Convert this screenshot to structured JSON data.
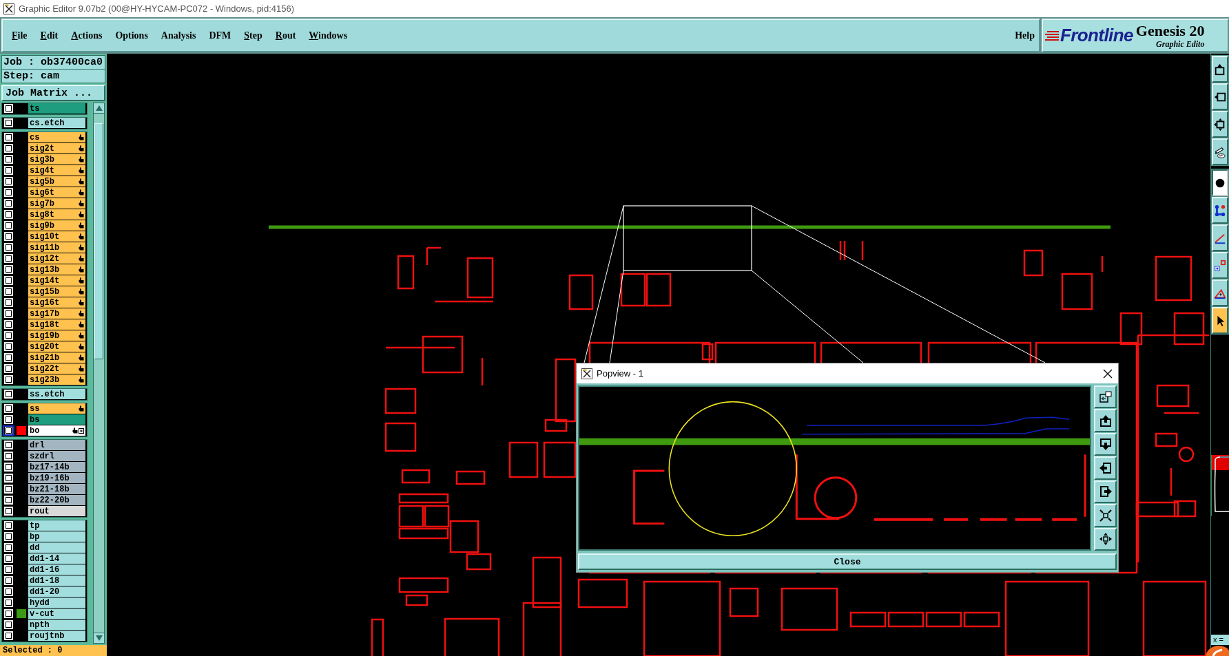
{
  "window": {
    "title": "Graphic Editor 9.07b2 (00@HY-HYCAM-PC072 - Windows, pid:4156)"
  },
  "menu_bar": {
    "items": [
      {
        "label": "File",
        "mnemonic": true
      },
      {
        "label": "Edit",
        "mnemonic": true
      },
      {
        "label": "Actions",
        "mnemonic": true
      },
      {
        "label": "Options",
        "mnemonic": false
      },
      {
        "label": "Analysis",
        "mnemonic": false
      },
      {
        "label": "DFM",
        "mnemonic": false
      },
      {
        "label": "Step",
        "mnemonic": true
      },
      {
        "label": "Rout",
        "mnemonic": true
      },
      {
        "label": "Windows",
        "mnemonic": true
      }
    ],
    "help": "Help"
  },
  "logo": {
    "brand": "Frontline",
    "product": "Genesis 20",
    "subtitle": "Graphic Edito"
  },
  "job_panel": {
    "job": "Job : ob37400ca0",
    "step": "Step: cam",
    "matrix_button": "Job Matrix ...",
    "layer_groups": [
      {
        "layers": [
          {
            "name": "ts",
            "kind": "mask",
            "checked": false,
            "selected": false,
            "hand_mark": false
          }
        ]
      },
      {
        "layers": [
          {
            "name": "cs.etch",
            "kind": "etch",
            "checked": false,
            "selected": false,
            "hand_mark": false
          }
        ]
      },
      {
        "layers": [
          {
            "name": "cs",
            "kind": "signal",
            "checked": false,
            "selected": false,
            "hand_mark": true
          },
          {
            "name": "sig2t",
            "kind": "signal",
            "checked": false,
            "selected": false,
            "hand_mark": true
          },
          {
            "name": "sig3b",
            "kind": "signal",
            "checked": false,
            "selected": false,
            "hand_mark": true
          },
          {
            "name": "sig4t",
            "kind": "signal",
            "checked": false,
            "selected": false,
            "hand_mark": true
          },
          {
            "name": "sig5b",
            "kind": "signal",
            "checked": false,
            "selected": false,
            "hand_mark": true
          },
          {
            "name": "sig6t",
            "kind": "signal",
            "checked": false,
            "selected": false,
            "hand_mark": true
          },
          {
            "name": "sig7b",
            "kind": "signal",
            "checked": false,
            "selected": false,
            "hand_mark": true
          },
          {
            "name": "sig8t",
            "kind": "signal",
            "checked": false,
            "selected": false,
            "hand_mark": true
          },
          {
            "name": "sig9b",
            "kind": "signal",
            "checked": false,
            "selected": false,
            "hand_mark": true
          },
          {
            "name": "sig10t",
            "kind": "signal",
            "checked": false,
            "selected": false,
            "hand_mark": true
          },
          {
            "name": "sig11b",
            "kind": "signal",
            "checked": false,
            "selected": false,
            "hand_mark": true
          },
          {
            "name": "sig12t",
            "kind": "signal",
            "checked": false,
            "selected": false,
            "hand_mark": true
          },
          {
            "name": "sig13b",
            "kind": "signal",
            "checked": false,
            "selected": false,
            "hand_mark": true
          },
          {
            "name": "sig14t",
            "kind": "signal",
            "checked": false,
            "selected": false,
            "hand_mark": true
          },
          {
            "name": "sig15b",
            "kind": "signal",
            "checked": false,
            "selected": false,
            "hand_mark": true
          },
          {
            "name": "sig16t",
            "kind": "signal",
            "checked": false,
            "selected": false,
            "hand_mark": true
          },
          {
            "name": "sig17b",
            "kind": "signal",
            "checked": false,
            "selected": false,
            "hand_mark": true
          },
          {
            "name": "sig18t",
            "kind": "signal",
            "checked": false,
            "selected": false,
            "hand_mark": true
          },
          {
            "name": "sig19b",
            "kind": "signal",
            "checked": false,
            "selected": false,
            "hand_mark": true
          },
          {
            "name": "sig20t",
            "kind": "signal",
            "checked": false,
            "selected": false,
            "hand_mark": true
          },
          {
            "name": "sig21b",
            "kind": "signal",
            "checked": false,
            "selected": false,
            "hand_mark": true
          },
          {
            "name": "sig22t",
            "kind": "signal",
            "checked": false,
            "selected": false,
            "hand_mark": true
          },
          {
            "name": "sig23b",
            "kind": "signal",
            "checked": false,
            "selected": false,
            "hand_mark": true
          }
        ]
      },
      {
        "layers": [
          {
            "name": "ss.etch",
            "kind": "etch",
            "checked": false,
            "selected": false,
            "hand_mark": false
          }
        ]
      },
      {
        "layers": [
          {
            "name": "ss",
            "kind": "signal",
            "checked": false,
            "selected": false,
            "hand_mark": true
          },
          {
            "name": "bs",
            "kind": "mask",
            "checked": false,
            "selected": false,
            "hand_mark": false
          },
          {
            "name": "bo",
            "kind": "signal",
            "checked": false,
            "selected": true,
            "hand_mark": true,
            "color": "#ff0000"
          }
        ]
      },
      {
        "layers": [
          {
            "name": "drl",
            "kind": "drill",
            "checked": false,
            "selected": false,
            "hand_mark": false
          },
          {
            "name": "szdrl",
            "kind": "drill",
            "checked": false,
            "selected": false,
            "hand_mark": false
          },
          {
            "name": "bz17-14b",
            "kind": "drill",
            "checked": false,
            "selected": false,
            "hand_mark": false
          },
          {
            "name": "bz19-16b",
            "kind": "drill",
            "checked": false,
            "selected": false,
            "hand_mark": false
          },
          {
            "name": "bz21-18b",
            "kind": "drill",
            "checked": false,
            "selected": false,
            "hand_mark": false
          },
          {
            "name": "bz22-20b",
            "kind": "drill",
            "checked": false,
            "selected": false,
            "hand_mark": false
          },
          {
            "name": "rout",
            "kind": "rout",
            "checked": false,
            "selected": false,
            "hand_mark": false
          }
        ]
      },
      {
        "layers": [
          {
            "name": "tp",
            "kind": "misc",
            "checked": false,
            "selected": false,
            "hand_mark": false
          },
          {
            "name": "bp",
            "kind": "misc",
            "checked": false,
            "selected": false,
            "hand_mark": false
          },
          {
            "name": "dd",
            "kind": "misc",
            "checked": false,
            "selected": false,
            "hand_mark": false
          },
          {
            "name": "dd1-14",
            "kind": "misc",
            "checked": false,
            "selected": false,
            "hand_mark": false
          },
          {
            "name": "dd1-16",
            "kind": "misc",
            "checked": false,
            "selected": false,
            "hand_mark": false
          },
          {
            "name": "dd1-18",
            "kind": "misc",
            "checked": false,
            "selected": false,
            "hand_mark": false
          },
          {
            "name": "dd1-20",
            "kind": "misc",
            "checked": false,
            "selected": false,
            "hand_mark": false
          },
          {
            "name": "hydd",
            "kind": "misc",
            "checked": false,
            "selected": false,
            "hand_mark": false
          },
          {
            "name": "v-cut",
            "kind": "misc",
            "checked": false,
            "selected": false,
            "hand_mark": false,
            "color": "#3c9a14"
          },
          {
            "name": "npth",
            "kind": "misc",
            "checked": false,
            "selected": false,
            "hand_mark": false
          },
          {
            "name": "roujtnb",
            "kind": "misc",
            "checked": false,
            "selected": false,
            "hand_mark": false
          }
        ]
      }
    ],
    "status": "Selected : 0"
  },
  "toolbar": {
    "tools": [
      {
        "selected": false,
        "on": false
      },
      {
        "selected": false,
        "on": false
      },
      {
        "selected": false,
        "on": false
      },
      {
        "selected": false,
        "on": false
      },
      {
        "selected": false,
        "on": true
      },
      {
        "selected": false,
        "on": false
      },
      {
        "selected": false,
        "on": false
      },
      {
        "selected": false,
        "on": false
      },
      {
        "selected": false,
        "on": false
      },
      {
        "selected": true,
        "on": false
      }
    ]
  },
  "popview": {
    "title": "Popview - 1",
    "close_button": "Close"
  },
  "coordinate_bar": {
    "label": "x ="
  }
}
